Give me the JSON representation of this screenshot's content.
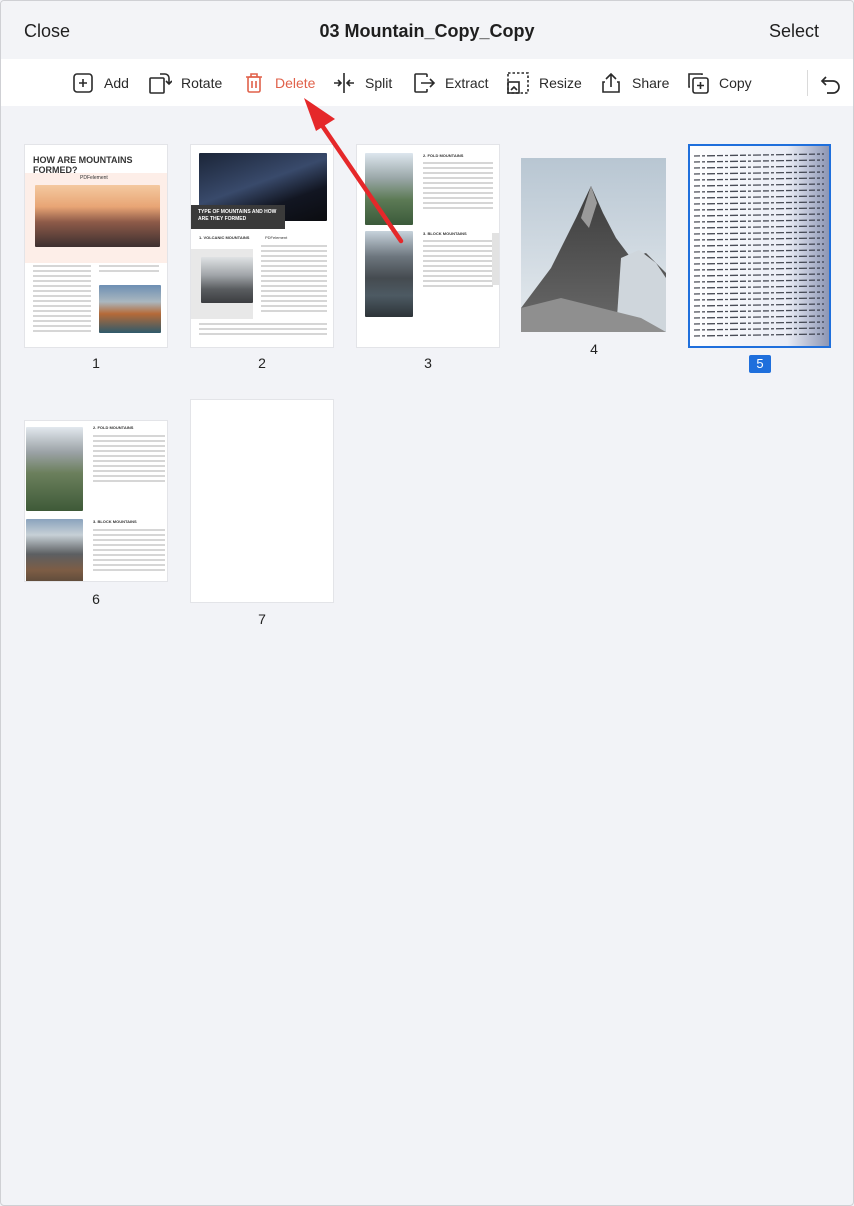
{
  "navbar": {
    "close_label": "Close",
    "title": "03 Mountain_Copy_Copy",
    "select_label": "Select"
  },
  "toolbar": {
    "add_label": "Add",
    "rotate_label": "Rotate",
    "delete_label": "Delete",
    "split_label": "Split",
    "extract_label": "Extract",
    "resize_label": "Resize",
    "share_label": "Share",
    "copy_label": "Copy"
  },
  "colors": {
    "accent": "#1f6fdc",
    "delete": "#e0614a",
    "arrow": "#e5282a"
  },
  "pages": [
    {
      "number": "1",
      "title": "HOW ARE MOUNTAINS FORMED?",
      "brand": "PDFelement"
    },
    {
      "number": "2",
      "banner": "TYPE OF MOUNTAINS AND HOW ARE THEY FORMED",
      "section": "1. VOLCANIC MOUNTAINS",
      "brand": "PDFelement"
    },
    {
      "number": "3",
      "section_a": "2. FOLD MOUNTAINS",
      "section_b": "3. BLOCK MOUNTAINS"
    },
    {
      "number": "4"
    },
    {
      "number": "5",
      "selected": true
    },
    {
      "number": "6",
      "section_a": "2. FOLD MOUNTAINS",
      "section_b": "3. BLOCK MOUNTAINS"
    },
    {
      "number": "7"
    }
  ]
}
